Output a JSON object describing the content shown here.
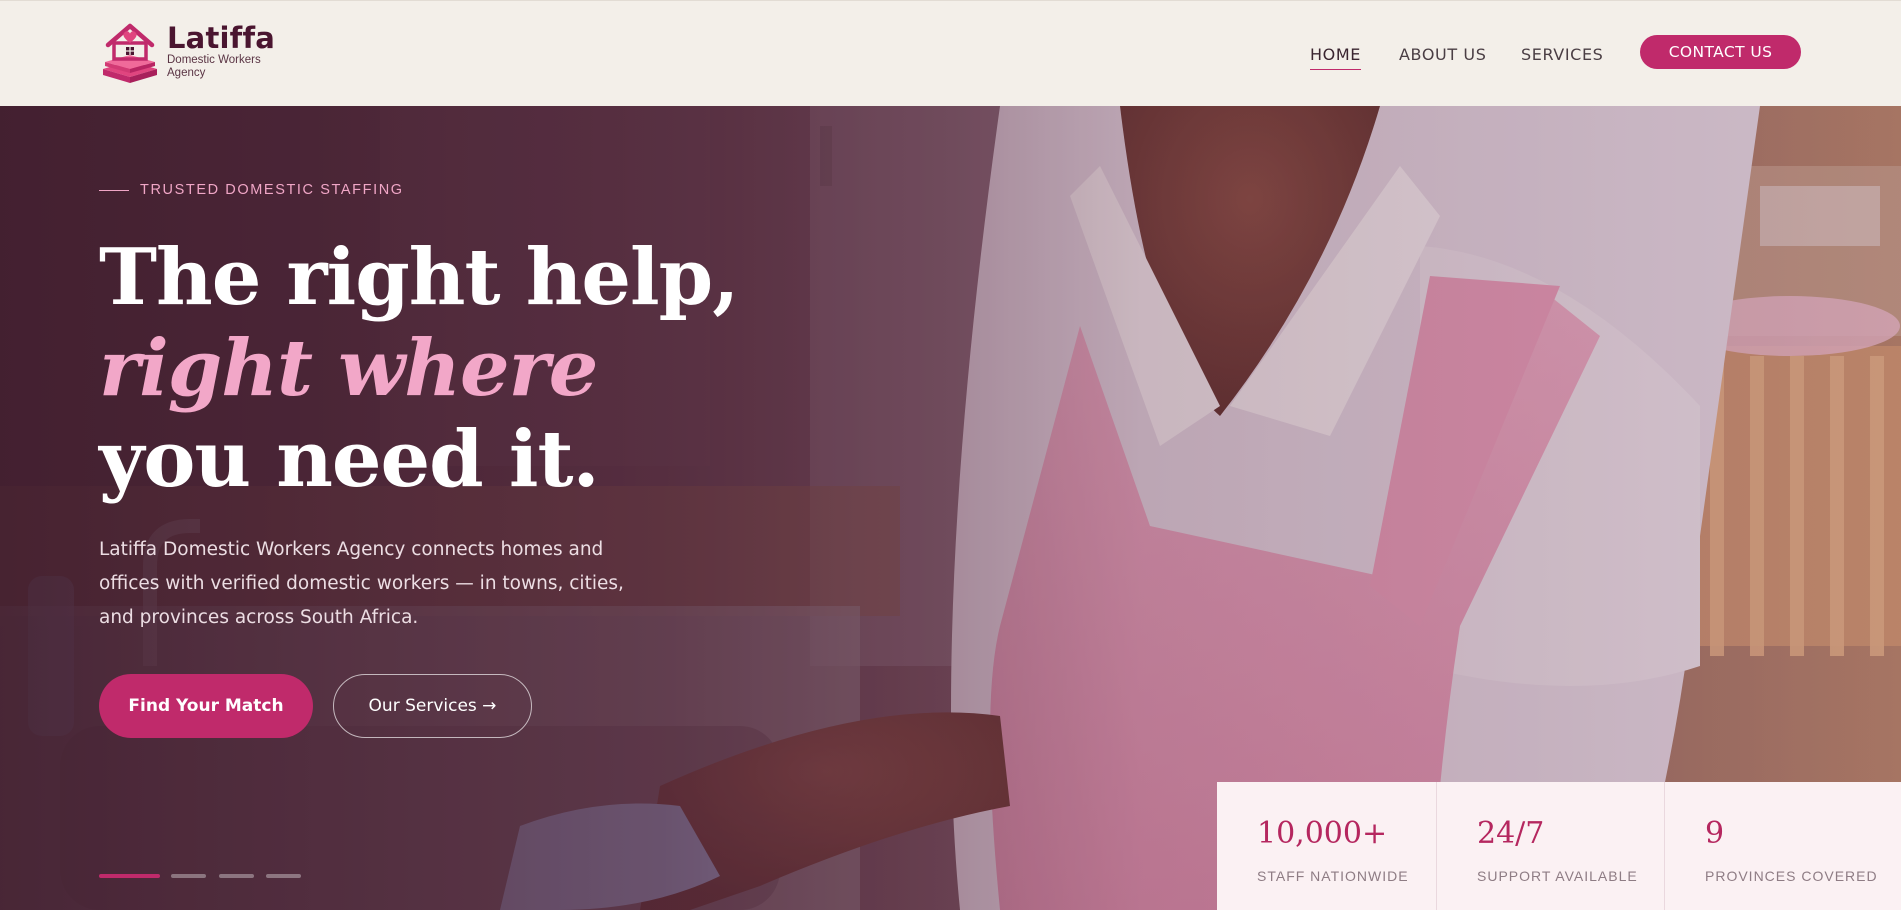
{
  "brand": {
    "name": "Latiffa",
    "tagline": "Domestic Workers Agency",
    "colors": {
      "accent": "#c02a6b",
      "accent_light": "#f2a7c8",
      "header_bg": "#f3efe9"
    }
  },
  "nav": {
    "items": [
      {
        "label": "HOME",
        "active": true
      },
      {
        "label": "ABOUT US",
        "active": false
      },
      {
        "label": "SERVICES",
        "active": false
      }
    ],
    "contact_label": "CONTACT US"
  },
  "hero": {
    "eyebrow": "TRUSTED DOMESTIC STAFFING",
    "headline_line1": "The right help,",
    "headline_line2": "right where",
    "headline_line3": "you need it.",
    "intro": "Latiffa Domestic Workers Agency connects homes and offices with verified domestic workers — in towns, cities, and provinces across South Africa.",
    "primary_button": "Find Your Match",
    "secondary_button": "Our Services →",
    "slides_total": 4,
    "active_slide": 1
  },
  "stats": [
    {
      "value": "10,000+",
      "label": "STAFF NATIONWIDE"
    },
    {
      "value": "24/7",
      "label": "SUPPORT AVAILABLE"
    },
    {
      "value": "9",
      "label": "PROVINCES COVERED"
    }
  ],
  "icons": {
    "logo": "house-with-heart-logo-icon"
  }
}
